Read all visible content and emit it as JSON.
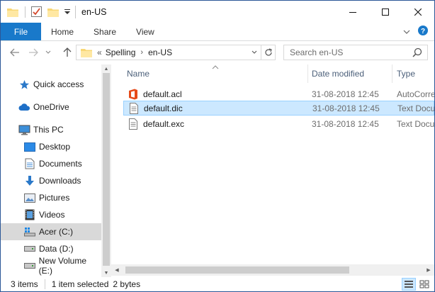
{
  "window": {
    "title": "en-US",
    "colors": {
      "accent": "#1979ca",
      "selection": "#cce8ff",
      "selection_border": "#99d1ff"
    }
  },
  "ribbon": {
    "tabs": [
      "File",
      "Home",
      "Share",
      "View"
    ]
  },
  "address": {
    "overflow": "«",
    "crumbs": [
      "Spelling",
      "en-US"
    ]
  },
  "search": {
    "placeholder": "Search en-US"
  },
  "nav": {
    "items": [
      {
        "label": "Quick access",
        "icon": "star-icon"
      },
      {
        "label": "OneDrive",
        "icon": "cloud-icon"
      },
      {
        "label": "This PC",
        "icon": "computer-icon"
      },
      {
        "label": "Desktop",
        "icon": "desktop-icon"
      },
      {
        "label": "Documents",
        "icon": "documents-icon"
      },
      {
        "label": "Downloads",
        "icon": "download-arrow-icon"
      },
      {
        "label": "Pictures",
        "icon": "pictures-icon"
      },
      {
        "label": "Videos",
        "icon": "videos-icon"
      },
      {
        "label": "Acer (C:)",
        "icon": "windows-drive-icon",
        "selected": true
      },
      {
        "label": "Data (D:)",
        "icon": "drive-icon"
      },
      {
        "label": "New Volume (E:)",
        "icon": "drive-icon"
      }
    ]
  },
  "files": {
    "columns": [
      "Name",
      "Date modified",
      "Type"
    ],
    "rows": [
      {
        "name": "default.acl",
        "date": "31-08-2018 12:45",
        "type": "AutoCorrect List File",
        "icon": "office-file-icon",
        "selected": false
      },
      {
        "name": "default.dic",
        "date": "31-08-2018 12:45",
        "type": "Text Document",
        "icon": "text-file-icon",
        "selected": true
      },
      {
        "name": "default.exc",
        "date": "31-08-2018 12:45",
        "type": "Text Document",
        "icon": "text-file-icon",
        "selected": false
      }
    ]
  },
  "status": {
    "items_count": "3 items",
    "selected": "1 item selected",
    "size": "2 bytes"
  }
}
